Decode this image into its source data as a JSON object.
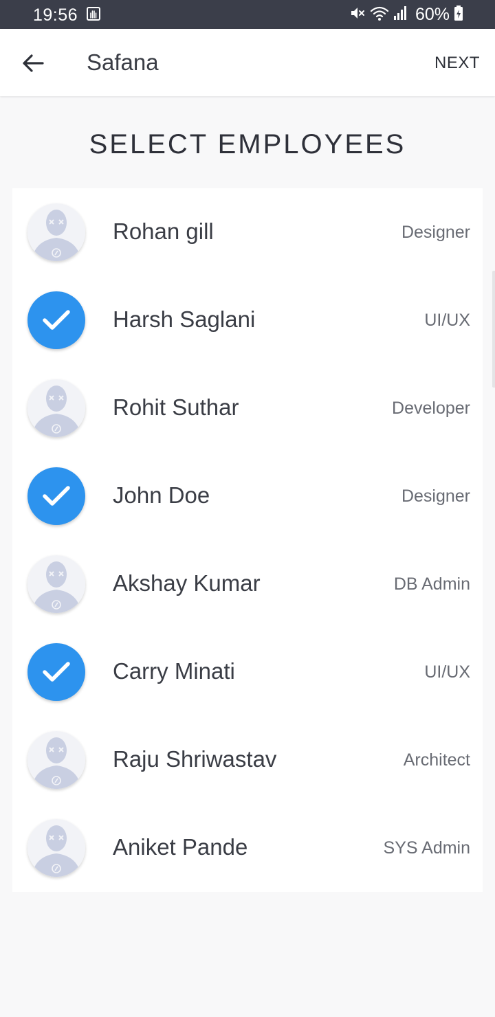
{
  "status_bar": {
    "time": "19:56",
    "battery_percent": "60%",
    "icons": [
      "notification-icon",
      "mute-icon",
      "wifi-icon",
      "signal-icon",
      "battery-charging-icon"
    ]
  },
  "app_bar": {
    "back_icon": "arrow-left-icon",
    "title": "Safana",
    "next_label": "NEXT"
  },
  "section_title": "SELECT EMPLOYEES",
  "colors": {
    "accent": "#2d93ee",
    "status_bar": "#3b3e4a",
    "background": "#f8f8f9"
  },
  "employees": [
    {
      "name": "Rohan gill",
      "role": "Designer",
      "selected": false
    },
    {
      "name": "Harsh Saglani",
      "role": "UI/UX",
      "selected": true
    },
    {
      "name": "Rohit Suthar",
      "role": "Developer",
      "selected": false
    },
    {
      "name": "John Doe",
      "role": "Designer",
      "selected": true
    },
    {
      "name": "Akshay Kumar",
      "role": "DB Admin",
      "selected": false
    },
    {
      "name": "Carry Minati",
      "role": "UI/UX",
      "selected": true
    },
    {
      "name": "Raju Shriwastav",
      "role": "Architect",
      "selected": false
    },
    {
      "name": "Aniket Pande",
      "role": "SYS Admin",
      "selected": false
    }
  ]
}
